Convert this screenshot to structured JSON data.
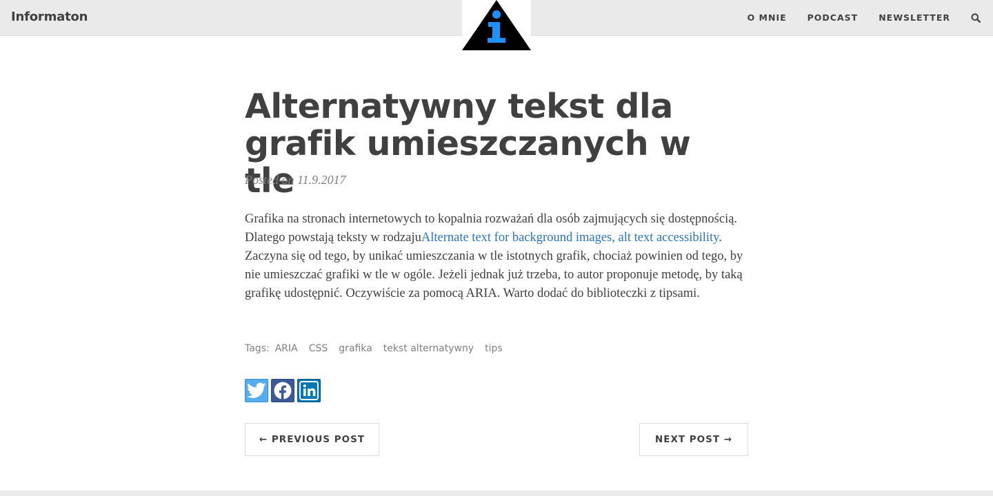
{
  "site": {
    "brand": "Informaton"
  },
  "nav": {
    "items": [
      {
        "label": "O MNIE"
      },
      {
        "label": "PODCAST"
      },
      {
        "label": "NEWSLETTER"
      }
    ],
    "search_icon": "search-icon"
  },
  "logo": {
    "icon": "info-triangle-logo",
    "colors": {
      "triangle": "#000000",
      "glyph": "#1e90ff"
    }
  },
  "post": {
    "title": "Alternatywny tekst dla grafik umieszczanych w tle",
    "meta": "Posted on 11.9.2017",
    "body_before_link": "Grafika na stronach internetowych to kopalnia rozważań dla osób zajmujących się dostępnością. Dlatego powstają teksty w rodzaju",
    "link_text": "Alternate text for background images, alt text accessibility",
    "body_after_link": ". Zaczyna się od tego, by unikać umieszczania w tle istotnych grafik, chociaż powinien od tego, by nie umieszczać grafiki w tle w ogóle. Jeżeli jednak już trzeba, to autor proponuje metodę, by taką grafikę udostępnić. Oczywiście za pomocą ARIA. Warto dodać do biblioteczki z tipsami.",
    "tags_label": "Tags:",
    "tags": [
      "ARIA",
      "CSS",
      "grafika",
      "tekst alternatywny",
      "tips"
    ],
    "share": [
      {
        "icon": "twitter-icon",
        "color": "#55acee"
      },
      {
        "icon": "facebook-icon",
        "color": "#3b5998"
      },
      {
        "icon": "linkedin-icon",
        "color": "#0077b5"
      }
    ],
    "pager": {
      "prev": "← PREVIOUS POST",
      "next": "NEXT POST →"
    }
  },
  "colors": {
    "text": "#404040",
    "muted": "#808080",
    "link": "#2a73c5",
    "navbar": "#eaeaea"
  }
}
